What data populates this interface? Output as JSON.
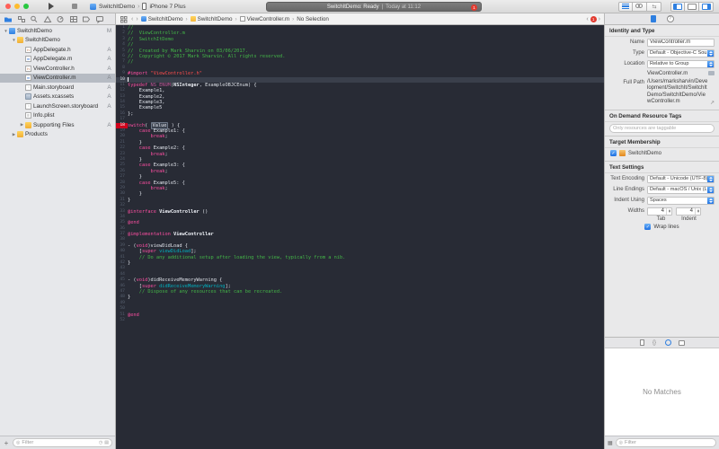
{
  "toolbar": {
    "scheme_name": "SwitchItDemo",
    "device_name": "iPhone 7 Plus",
    "status_primary": "SwitchItDemo: Ready",
    "status_separator": "|",
    "status_time": "Today at 11:12",
    "error_count": "1"
  },
  "jumpbar": {
    "back": "‹",
    "forward": "›",
    "crumbs": [
      {
        "label": "SwitchItDemo",
        "icon": "proj-blue"
      },
      {
        "label": "SwitchItDemo",
        "icon": "ic-folder-y"
      },
      {
        "label": "ViewController.m",
        "icon": "ic-doc-gray"
      },
      {
        "label": "No Selection",
        "icon": ""
      }
    ],
    "issue_count": "1"
  },
  "navigator": {
    "items": [
      {
        "depth": 0,
        "disclosure": "v",
        "icon": "project",
        "label": "SwitchItDemo",
        "status": "M",
        "selected": false
      },
      {
        "depth": 1,
        "disclosure": "v",
        "icon": "folder",
        "label": "SwitchItDemo",
        "status": "",
        "selected": false
      },
      {
        "depth": 2,
        "disclosure": "",
        "icon": "file-h",
        "label": "AppDelegate.h",
        "status": "A",
        "selected": false
      },
      {
        "depth": 2,
        "disclosure": "",
        "icon": "file-m",
        "label": "AppDelegate.m",
        "status": "A",
        "selected": false
      },
      {
        "depth": 2,
        "disclosure": "",
        "icon": "file-h",
        "label": "ViewController.h",
        "status": "A",
        "selected": false
      },
      {
        "depth": 2,
        "disclosure": "",
        "icon": "file-m",
        "label": "ViewController.m",
        "status": "A",
        "selected": true
      },
      {
        "depth": 2,
        "disclosure": "",
        "icon": "storyboard",
        "label": "Main.storyboard",
        "status": "A",
        "selected": false
      },
      {
        "depth": 2,
        "disclosure": "",
        "icon": "xcassets",
        "label": "Assets.xcassets",
        "status": "A",
        "selected": false
      },
      {
        "depth": 2,
        "disclosure": "",
        "icon": "storyboard",
        "label": "LaunchScreen.storyboard",
        "status": "A",
        "selected": false
      },
      {
        "depth": 2,
        "disclosure": "",
        "icon": "plist",
        "label": "Info.plist",
        "status": "",
        "selected": false
      },
      {
        "depth": 2,
        "disclosure": ">",
        "icon": "folder",
        "label": "Supporting Files",
        "status": "A",
        "selected": false
      },
      {
        "depth": 1,
        "disclosure": ">",
        "icon": "folder",
        "label": "Products",
        "status": "",
        "selected": false
      }
    ],
    "filter_placeholder": "Filter"
  },
  "editor": {
    "lines": [
      {
        "n": 1,
        "t": [
          [
            "c",
            "//"
          ]
        ]
      },
      {
        "n": 2,
        "t": [
          [
            "c",
            "//  ViewController.m"
          ]
        ]
      },
      {
        "n": 3,
        "t": [
          [
            "c",
            "//  SwitchItDemo"
          ]
        ]
      },
      {
        "n": 4,
        "t": [
          [
            "c",
            "//"
          ]
        ]
      },
      {
        "n": 5,
        "t": [
          [
            "c",
            "//  Created by Mark Sharvin on 03/06/2017."
          ]
        ]
      },
      {
        "n": 6,
        "t": [
          [
            "c",
            "//  Copyright © 2017 Mark Sharvin. All rights reserved."
          ]
        ]
      },
      {
        "n": 7,
        "t": [
          [
            "c",
            "//"
          ]
        ]
      },
      {
        "n": 8,
        "t": []
      },
      {
        "n": 9,
        "t": [
          [
            "k",
            "#import"
          ],
          [
            "p",
            " "
          ],
          [
            "s",
            "\"ViewController.h\""
          ]
        ]
      },
      {
        "n": 10,
        "t": [],
        "f": "cur"
      },
      {
        "n": 11,
        "t": [
          [
            "k",
            "typedef "
          ],
          [
            "m",
            "NS_ENUM"
          ],
          [
            "p",
            "("
          ],
          [
            "b",
            "NSInteger"
          ],
          [
            "p",
            ", ExampleOBJCEnum) {"
          ]
        ]
      },
      {
        "n": 12,
        "t": [
          [
            "p",
            "    Example1,"
          ]
        ]
      },
      {
        "n": 13,
        "t": [
          [
            "p",
            "    Example2,"
          ]
        ]
      },
      {
        "n": 14,
        "t": [
          [
            "p",
            "    Example3,"
          ]
        ]
      },
      {
        "n": 15,
        "t": [
          [
            "p",
            "    Example5"
          ]
        ]
      },
      {
        "n": 16,
        "t": [
          [
            "p",
            "};"
          ]
        ]
      },
      {
        "n": 17,
        "t": []
      },
      {
        "n": 18,
        "t": [
          [
            "k",
            "switch"
          ],
          [
            "p",
            "( "
          ],
          [
            "e",
            "Value"
          ],
          [
            "p",
            " ) {"
          ]
        ],
        "f": "err"
      },
      {
        "n": 19,
        "t": [
          [
            "p",
            "    "
          ],
          [
            "k",
            "case"
          ],
          [
            "p",
            " Example1: {"
          ]
        ]
      },
      {
        "n": 20,
        "t": [
          [
            "p",
            "        "
          ],
          [
            "k",
            "break"
          ],
          [
            "p",
            ";"
          ]
        ]
      },
      {
        "n": 21,
        "t": [
          [
            "p",
            "    }"
          ]
        ]
      },
      {
        "n": 22,
        "t": [
          [
            "p",
            "    "
          ],
          [
            "k",
            "case"
          ],
          [
            "p",
            " Example2: {"
          ]
        ]
      },
      {
        "n": 23,
        "t": [
          [
            "p",
            "        "
          ],
          [
            "k",
            "break"
          ],
          [
            "p",
            ";"
          ]
        ]
      },
      {
        "n": 24,
        "t": [
          [
            "p",
            "    }"
          ]
        ]
      },
      {
        "n": 25,
        "t": [
          [
            "p",
            "    "
          ],
          [
            "k",
            "case"
          ],
          [
            "p",
            " Example3: {"
          ]
        ]
      },
      {
        "n": 26,
        "t": [
          [
            "p",
            "        "
          ],
          [
            "k",
            "break"
          ],
          [
            "p",
            ";"
          ]
        ]
      },
      {
        "n": 27,
        "t": [
          [
            "p",
            "    }"
          ]
        ]
      },
      {
        "n": 28,
        "t": [
          [
            "p",
            "    "
          ],
          [
            "k",
            "case"
          ],
          [
            "p",
            " Example5: {"
          ]
        ]
      },
      {
        "n": 29,
        "t": [
          [
            "p",
            "        "
          ],
          [
            "k",
            "break"
          ],
          [
            "p",
            ";"
          ]
        ]
      },
      {
        "n": 30,
        "t": [
          [
            "p",
            "    }"
          ]
        ]
      },
      {
        "n": 31,
        "t": [
          [
            "p",
            "}"
          ]
        ]
      },
      {
        "n": 32,
        "t": []
      },
      {
        "n": 33,
        "t": [
          [
            "k",
            "@interface"
          ],
          [
            "p",
            " "
          ],
          [
            "b",
            "ViewController"
          ],
          [
            "p",
            " ()"
          ]
        ]
      },
      {
        "n": 34,
        "t": []
      },
      {
        "n": 35,
        "t": [
          [
            "k",
            "@end"
          ]
        ]
      },
      {
        "n": 36,
        "t": []
      },
      {
        "n": 37,
        "t": [
          [
            "k",
            "@implementation"
          ],
          [
            "p",
            " "
          ],
          [
            "b",
            "ViewController"
          ]
        ]
      },
      {
        "n": 38,
        "t": []
      },
      {
        "n": 39,
        "t": [
          [
            "p",
            "- ("
          ],
          [
            "k",
            "void"
          ],
          [
            "p",
            ")viewDidLoad {"
          ]
        ]
      },
      {
        "n": 40,
        "t": [
          [
            "p",
            "    ["
          ],
          [
            "k",
            "super"
          ],
          [
            "p",
            " "
          ],
          [
            "t",
            "viewDidLoad"
          ],
          [
            "p",
            "];"
          ]
        ]
      },
      {
        "n": 41,
        "t": [
          [
            "c",
            "    // Do any additional setup after loading the view, typically from a nib."
          ]
        ]
      },
      {
        "n": 42,
        "t": [
          [
            "p",
            "}"
          ]
        ]
      },
      {
        "n": 43,
        "t": []
      },
      {
        "n": 44,
        "t": []
      },
      {
        "n": 45,
        "t": [
          [
            "p",
            "- ("
          ],
          [
            "k",
            "void"
          ],
          [
            "p",
            ")didReceiveMemoryWarning {"
          ]
        ]
      },
      {
        "n": 46,
        "t": [
          [
            "p",
            "    ["
          ],
          [
            "k",
            "super"
          ],
          [
            "p",
            " "
          ],
          [
            "t",
            "didReceiveMemoryWarning"
          ],
          [
            "p",
            "];"
          ]
        ]
      },
      {
        "n": 47,
        "t": [
          [
            "c",
            "    // Dispose of any resources that can be recreated."
          ]
        ]
      },
      {
        "n": 48,
        "t": [
          [
            "p",
            "}"
          ]
        ]
      },
      {
        "n": 49,
        "t": []
      },
      {
        "n": 50,
        "t": []
      },
      {
        "n": 51,
        "t": [
          [
            "k",
            "@end"
          ]
        ]
      },
      {
        "n": 52,
        "t": []
      }
    ]
  },
  "inspector": {
    "identity_header": "Identity and Type",
    "name_label": "Name",
    "name_value": "ViewController.m",
    "type_label": "Type",
    "type_value": "Default - Objective-C Sou...",
    "location_label": "Location",
    "location_value": "Relative to Group",
    "location_file": "ViewController.m",
    "fullpath_label": "Full Path",
    "fullpath_value": "/Users/marksharvin/Development/SwitchIt/SwitchItDemo/SwitchItDemo/ViewController.m",
    "odr_header": "On Demand Resource Tags",
    "odr_placeholder": "Only resources are taggable",
    "target_header": "Target Membership",
    "target_item": "SwitchItDemo",
    "text_settings_header": "Text Settings",
    "text_encoding_label": "Text Encoding",
    "text_encoding_value": "Default - Unicode (UTF-8)",
    "line_endings_label": "Line Endings",
    "line_endings_value": "Default - macOS / Unix (LF)",
    "indent_using_label": "Indent Using",
    "indent_using_value": "Spaces",
    "widths_label": "Widths",
    "tab_width": "4",
    "indent_width": "4",
    "tab_col_label": "Tab",
    "indent_col_label": "Indent",
    "wrap_label": "Wrap lines"
  },
  "library": {
    "empty_text": "No Matches",
    "filter_placeholder": "Filter"
  },
  "colors": {
    "accent_blue": "#2e7fe0",
    "error_red": "#d0021b",
    "editor_bg": "#282b35"
  }
}
